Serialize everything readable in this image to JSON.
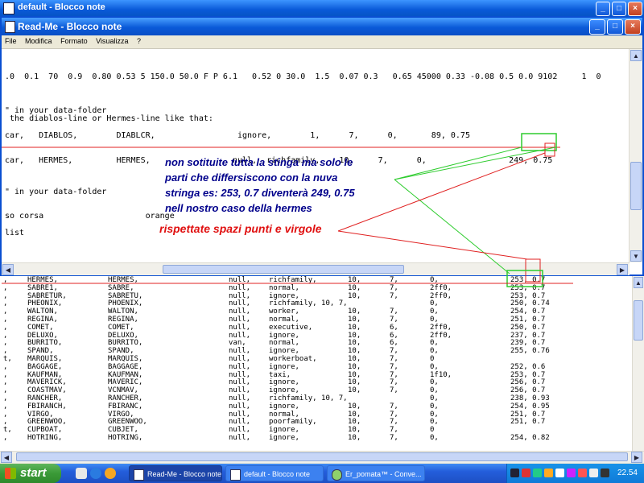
{
  "background_window": {
    "title": "default - Blocco note"
  },
  "window": {
    "title": "Read-Me - Blocco note",
    "menu": [
      "File",
      "Modifica",
      "Formato",
      "Visualizza",
      "?"
    ]
  },
  "editor_lines": [
    ".0  0.1  70  0.9  0.80 0.53 5 150.0 50.0 F P 6.1   0.52 0 30.0  1.5  0.07 0.3   0.65 45000 0.33 -0.08 0.5 0.0 9102     1  0",
    "\" in your data-folder",
    " the diablos-line or Hermes-line like that:",
    "car,   DIABLOS,        DIABLCR,                 ignore,        1,      7,      0,       89, 0.75",
    "car,   HERMES,         HERMES,                 null,  richfamily,    10,     7,      0,                 249, 0.75",
    "\" in your data-folder",
    "so corsa                     orange",
    "list"
  ],
  "annotations": {
    "note1": [
      "non sotituite tutta la stinga ma solo le",
      "parti che differsiscono con la nuva",
      "stringa es: 253, 0.7 diventerà 249, 0.75",
      "nell nostro caso della hermes"
    ],
    "note2": "rispettate spazi punti e virgole"
  },
  "lower_rows": [
    [
      ",",
      "HERMES,",
      "HERMES,",
      "null,",
      "richfamily,",
      "10,",
      "7,",
      "0,",
      "253, 0.7"
    ],
    [
      ",",
      "SABRE1,",
      "SABRE,",
      "null,",
      "normal,",
      "10,",
      "7,",
      "2ff0,",
      "253, 0.7"
    ],
    [
      ",",
      "SABRETUR,",
      "SABRETU,",
      "null,",
      "ignore,",
      "10,",
      "7,",
      "2ff0,",
      "253, 0.7"
    ],
    [
      ",",
      "PHEONIX,",
      "PHOENIX,",
      "null,",
      "richfamily, 10, 7,",
      "",
      "",
      "0,",
      "250, 0.74"
    ],
    [
      ",",
      "WALTON,",
      "WALTON,",
      "null,",
      "worker,",
      "10,",
      "7,",
      "0,",
      "254, 0.7"
    ],
    [
      ",",
      "REGINA,",
      "REGINA,",
      "null,",
      "normal,",
      "10,",
      "7,",
      "0,",
      "251, 0.7"
    ],
    [
      ",",
      "COMET,",
      "COMET,",
      "null,",
      "executive,",
      "10,",
      "6,",
      "2ff0,",
      "250, 0.7"
    ],
    [
      ",",
      "DELUXO,",
      "DELUXO,",
      "null,",
      "ignore,",
      "10,",
      "6,",
      "2ff0,",
      "237, 0.7"
    ],
    [
      ",",
      "BURRITO,",
      "BURRITO,",
      "van,",
      "normal,",
      "10,",
      "6,",
      "0,",
      "239, 0.7"
    ],
    [
      ",",
      "SPAND,",
      "SPAND,",
      "null,",
      "ignore,",
      "10,",
      "7,",
      "0,",
      "255, 0.76"
    ],
    [
      "t,",
      "MARQUIS,",
      "MARQUIS,",
      "null,",
      "workerboat,",
      "10,",
      "7,",
      "0",
      ""
    ],
    [
      ",",
      "BAGGAGE,",
      "BAGGAGE,",
      "null,",
      "ignore,",
      "10,",
      "7,",
      "0,",
      "252, 0.6"
    ],
    [
      ",",
      "KAUFMAN,",
      "KAUFMAN,",
      "null,",
      "taxi,",
      "10,",
      "7,",
      "1f10,",
      "253, 0.7"
    ],
    [
      ",",
      "MAVERICK,",
      "MAVERIC,",
      "null,",
      "ignore,",
      "10,",
      "7,",
      "0,",
      "256, 0.7"
    ],
    [
      ",",
      "COASTMAV,",
      "VCNMAV,",
      "null,",
      "ignore,",
      "10,",
      "7,",
      "0,",
      "256, 0.7"
    ],
    [
      ",",
      "RANCHER,",
      "RANCHER,",
      "null,",
      "richfamily, 10, 7,",
      "",
      "",
      "0,",
      "238, 0.93"
    ],
    [
      ",",
      "FBIRANCH,",
      "FBIRANC,",
      "null,",
      "ignore,",
      "10,",
      "7,",
      "0,",
      "254, 0.95"
    ],
    [
      ",",
      "VIRGO,",
      "VIRGO,",
      "null,",
      "normal,",
      "10,",
      "7,",
      "0,",
      "251, 0.7"
    ],
    [
      ",",
      "GREENWOO,",
      "GREENWOO,",
      "null,",
      "poorfamily,",
      "10,",
      "7,",
      "0,",
      "251, 0.7"
    ],
    [
      "t,",
      "CUPBOAT,",
      "CUBJET,",
      "null,",
      "ignore,",
      "10,",
      "7,",
      "0",
      ""
    ],
    [
      ",",
      "HOTRING,",
      "HOTRING,",
      "null,",
      "ignore,",
      "10,",
      "7,",
      "0,",
      "254, 0.82"
    ]
  ],
  "taskbar": {
    "start_label": "start",
    "tasks": [
      "Read-Me - Blocco note",
      "default - Blocco note",
      "Er_pomata™ - Conve..."
    ],
    "clock": "22.54"
  }
}
